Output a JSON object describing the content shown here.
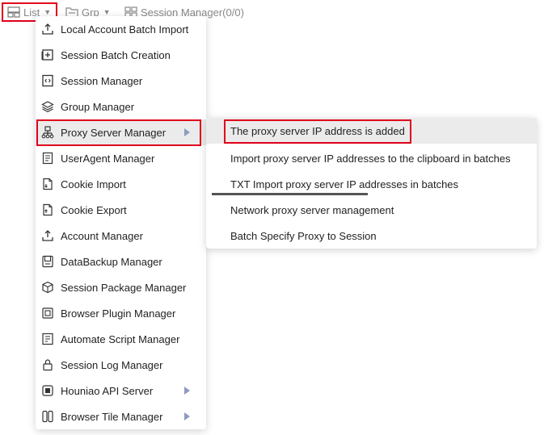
{
  "toolbar": {
    "list_label": "List",
    "grp_label": "Grp",
    "session_manager_label": "Session Manager(0/0)"
  },
  "menu": {
    "items": [
      {
        "label": "Local Account Batch Import",
        "icon": "upload-icon"
      },
      {
        "label": "Session Batch Creation",
        "icon": "add-box-icon"
      },
      {
        "label": "Session Manager",
        "icon": "code-window-icon"
      },
      {
        "label": "Group Manager",
        "icon": "layers-icon"
      },
      {
        "label": "Proxy Server Manager",
        "icon": "network-icon"
      },
      {
        "label": "UserAgent Manager",
        "icon": "document-list-icon"
      },
      {
        "label": "Cookie Import",
        "icon": "file-import-icon"
      },
      {
        "label": "Cookie Export",
        "icon": "file-export-icon"
      },
      {
        "label": "Account Manager",
        "icon": "upload-icon"
      },
      {
        "label": "DataBackup Manager",
        "icon": "backup-icon"
      },
      {
        "label": "Session Package Manager",
        "icon": "package-icon"
      },
      {
        "label": "Browser Plugin Manager",
        "icon": "plugin-icon"
      },
      {
        "label": "Automate Script Manager",
        "icon": "script-icon"
      },
      {
        "label": "Session Log Manager",
        "icon": "lock-icon"
      },
      {
        "label": "Houniao API Server",
        "icon": "api-icon"
      },
      {
        "label": "Browser Tile Manager",
        "icon": "tile-icon"
      }
    ]
  },
  "submenu": {
    "items": [
      {
        "label": "The proxy server IP address is added"
      },
      {
        "label": "Import proxy server IP addresses to the clipboard in batches"
      },
      {
        "label": "TXT Import proxy server IP addresses in batches"
      },
      {
        "label": "Network proxy server management"
      },
      {
        "label": "Batch Specify Proxy to Session"
      }
    ]
  },
  "colors": {
    "highlight_border": "#e0001b",
    "active_bg": "#ebebeb",
    "arrow": "#8e9bbf"
  }
}
